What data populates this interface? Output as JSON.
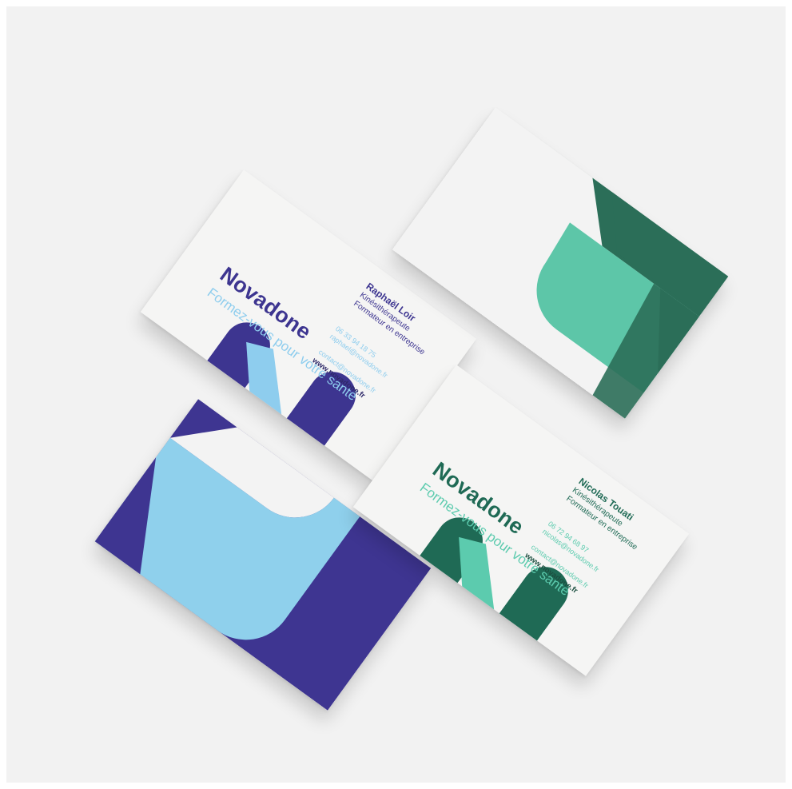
{
  "cards": {
    "purple_front": {
      "name": "Raphaël Loir",
      "role_1": "Kinésithérapeute",
      "role_2": "Formateur en entreprise",
      "phone": "06 33 94 18 75",
      "email": "raphael@novadone.fr",
      "contact_email": "contact@novadone.fr",
      "website": "www.novadone.fr",
      "brand": "Novadone",
      "slogan": "Formez-vous pour votre santé",
      "colors": {
        "primary": "#3d3590",
        "accent": "#8ecdee",
        "paper": "#f5f5f4"
      }
    },
    "green_front": {
      "name": "Nicolas Touati",
      "role_1": "Kinésithérapeute",
      "role_2": "Formateur en entreprise",
      "phone": "06 72 94 68 97",
      "email": "nicolas@novadone.fr",
      "contact_email": "contact@novadone.fr",
      "website": "www.novadone.fr",
      "brand": "Novadone",
      "slogan": "Formez-vous pour votre santé",
      "colors": {
        "primary": "#1f6a55",
        "accent": "#5ccbae",
        "paper": "#f5f5f4"
      }
    },
    "purple_back": {
      "colors": {
        "dark": "#3e3591",
        "light": "#8fd0ec",
        "paper": "#f3f3f3"
      }
    },
    "green_back": {
      "colors": {
        "dark": "#2b6e58",
        "light": "#5dc6a8",
        "paper": "#f3f3f3"
      }
    }
  }
}
